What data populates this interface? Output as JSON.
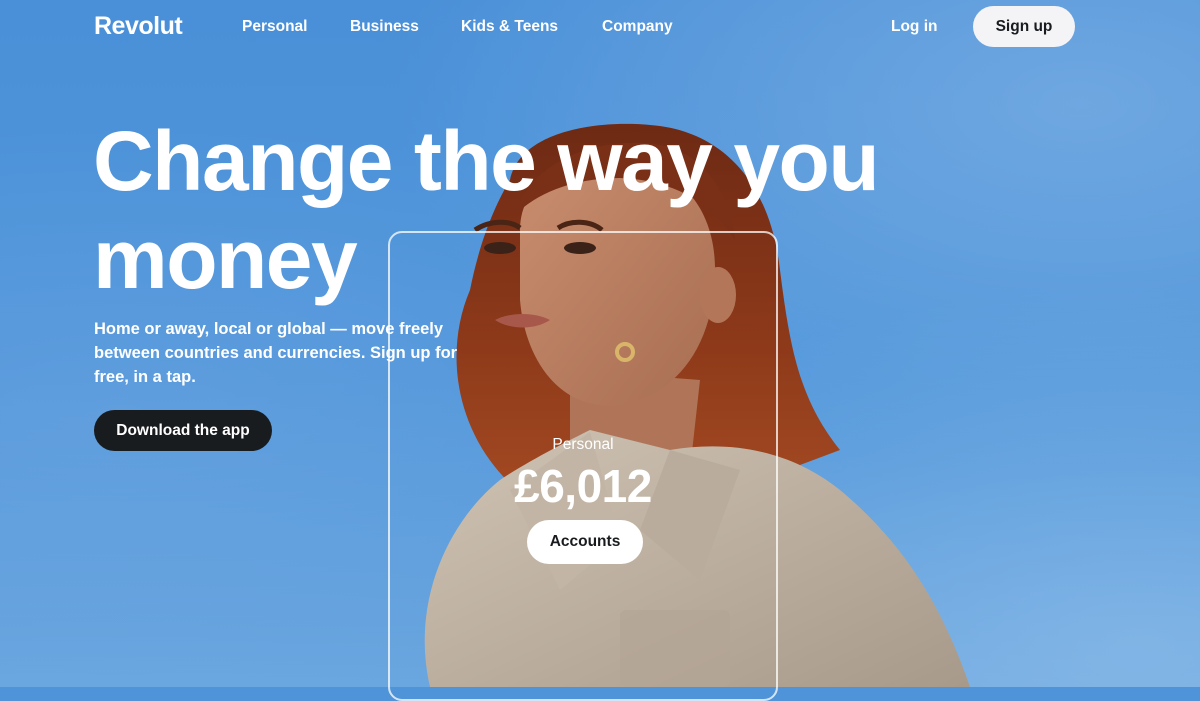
{
  "brand": {
    "logo_text": "Revolut"
  },
  "nav": {
    "items": [
      {
        "label": "Personal"
      },
      {
        "label": "Business"
      },
      {
        "label": "Kids & Teens"
      },
      {
        "label": "Company"
      }
    ],
    "login_label": "Log in",
    "signup_label": "Sign up"
  },
  "hero": {
    "headline_line1": "Change the way you",
    "headline_line2": "money",
    "subtext": "Home or away, local or global — move freely between countries and currencies. Sign up for free, in a tap.",
    "download_label": "Download the app"
  },
  "card": {
    "label": "Personal",
    "amount": "£6,012",
    "button_label": "Accounts"
  },
  "colors": {
    "sky": "#4f94d8",
    "dark_button": "#191c1f",
    "light_button": "#f4f4f6"
  }
}
